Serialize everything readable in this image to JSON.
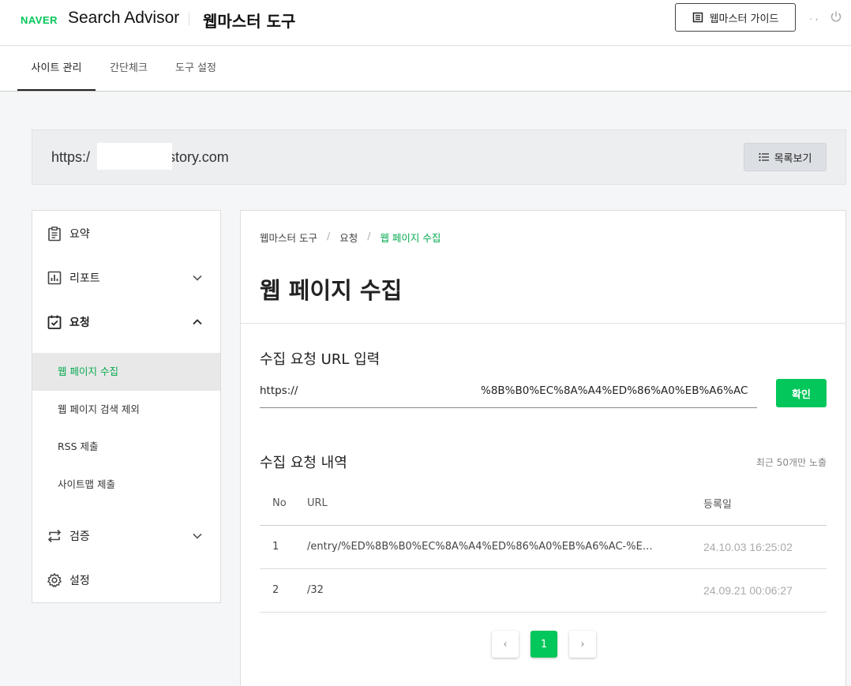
{
  "header": {
    "brand": "NAVER",
    "product": "Search Advisor",
    "tool_title": "웹마스터 도구",
    "guide_button": "웹마스터 가이드",
    "user_dots": ". ,",
    "accent": "#03c75a"
  },
  "tabs": [
    {
      "label": "사이트 관리",
      "active": true
    },
    {
      "label": "간단체크",
      "active": false
    },
    {
      "label": "도구 설정",
      "active": false
    }
  ],
  "site": {
    "url_prefix": "https:/",
    "url_suffix": "istory.com",
    "list_button": "목록보기"
  },
  "sidebar": {
    "items": [
      {
        "label": "요약",
        "icon": "clipboard-icon"
      },
      {
        "label": "리포트",
        "icon": "chart-icon",
        "expanded": false
      },
      {
        "label": "요청",
        "icon": "calendar-check-icon",
        "expanded": true
      },
      {
        "label": "검증",
        "icon": "arrows-swap-icon",
        "expanded": false
      },
      {
        "label": "설정",
        "icon": "gear-icon"
      }
    ],
    "sub_items": [
      {
        "label": "웹 페이지 수집",
        "active": true
      },
      {
        "label": "웹 페이지 검색 제외",
        "active": false
      },
      {
        "label": "RSS 제출",
        "active": false
      },
      {
        "label": "사이트맵 제출",
        "active": false
      }
    ]
  },
  "main": {
    "breadcrumb": [
      "웹마스터 도구",
      "요청",
      "웹 페이지 수집"
    ],
    "breadcrumb_sep": "/",
    "title": "웹 페이지 수집",
    "input_section_title": "수집 요청 URL 입력",
    "input_prefix": "https://",
    "input_value": "%8B%B0%EC%8A%A4%ED%86%A0%EB%A6%AC",
    "confirm_button": "확인",
    "history_title": "수집 요청 내역",
    "history_note": "최근 50개만 노출",
    "table": {
      "headers": [
        "No",
        "URL",
        "등록일"
      ],
      "rows": [
        {
          "no": "1",
          "url": "/entry/%ED%8B%B0%EC%8A%A4%ED%86%A0%EB%A6%AC-%E…",
          "date": "24.10.03 16:25:02"
        },
        {
          "no": "2",
          "url": "/32",
          "date": "24.09.21 00:06:27"
        }
      ]
    },
    "pager": {
      "prev": "‹",
      "current": "1",
      "next": "›"
    }
  }
}
